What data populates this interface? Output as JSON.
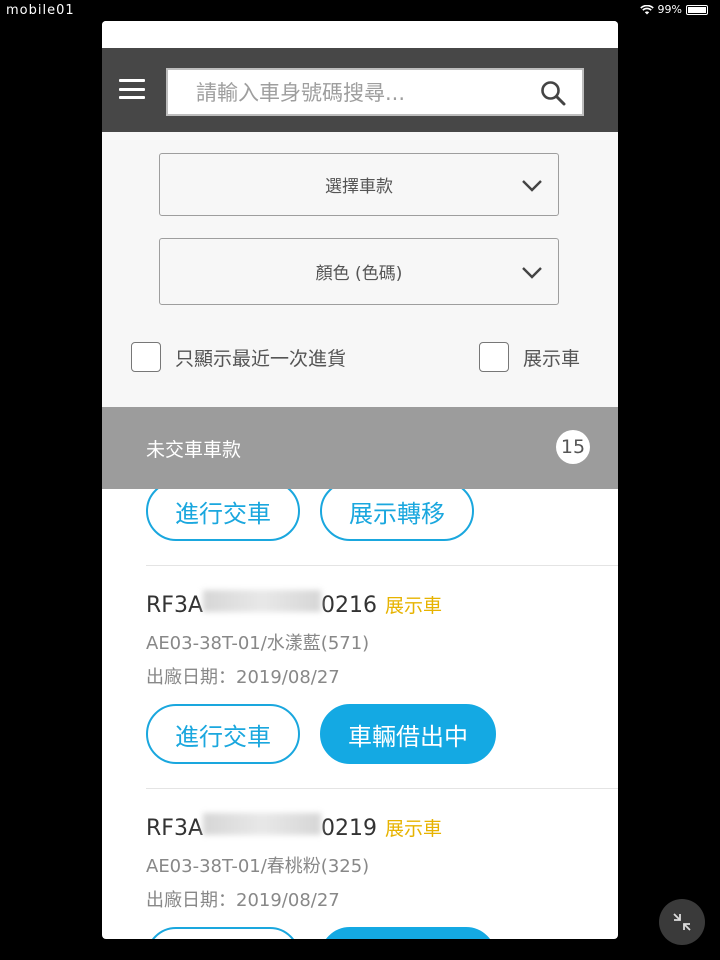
{
  "status_bar": {
    "left_text": "mobile01",
    "battery": "99%"
  },
  "search": {
    "placeholder": "請輸入車身號碼搜尋..."
  },
  "filters": {
    "model_select": "選擇車款",
    "color_select": "顏色 (色碼)",
    "checkbox_recent": "只顯示最近一次進貨",
    "checkbox_demo": "展示車"
  },
  "section": {
    "title": "未交車車款",
    "count": "15"
  },
  "vehicles": [
    {
      "buttons": [
        "進行交車",
        "展示轉移"
      ]
    },
    {
      "vin_prefix": "RF3A",
      "vin_suffix": "0216",
      "badge": "展示車",
      "model": "AE03-38T-01/水漾藍(571)",
      "date": "出廠日期：2019/08/27",
      "buttons": [
        "進行交車",
        "車輛借出中"
      ]
    },
    {
      "vin_prefix": "RF3A",
      "vin_suffix": "0219",
      "badge": "展示車",
      "model": "AE03-38T-01/春桃粉(325)",
      "date": "出廠日期：2019/08/27"
    }
  ],
  "colors": {
    "accent": "#14a9e3",
    "header_bg": "#474747",
    "section_bg": "#9c9c9c",
    "badge": "#e7b300"
  },
  "icons": [
    "menu-icon",
    "search-icon",
    "chevron-down-icon",
    "minimize-icon",
    "wifi-icon",
    "battery-icon"
  ]
}
